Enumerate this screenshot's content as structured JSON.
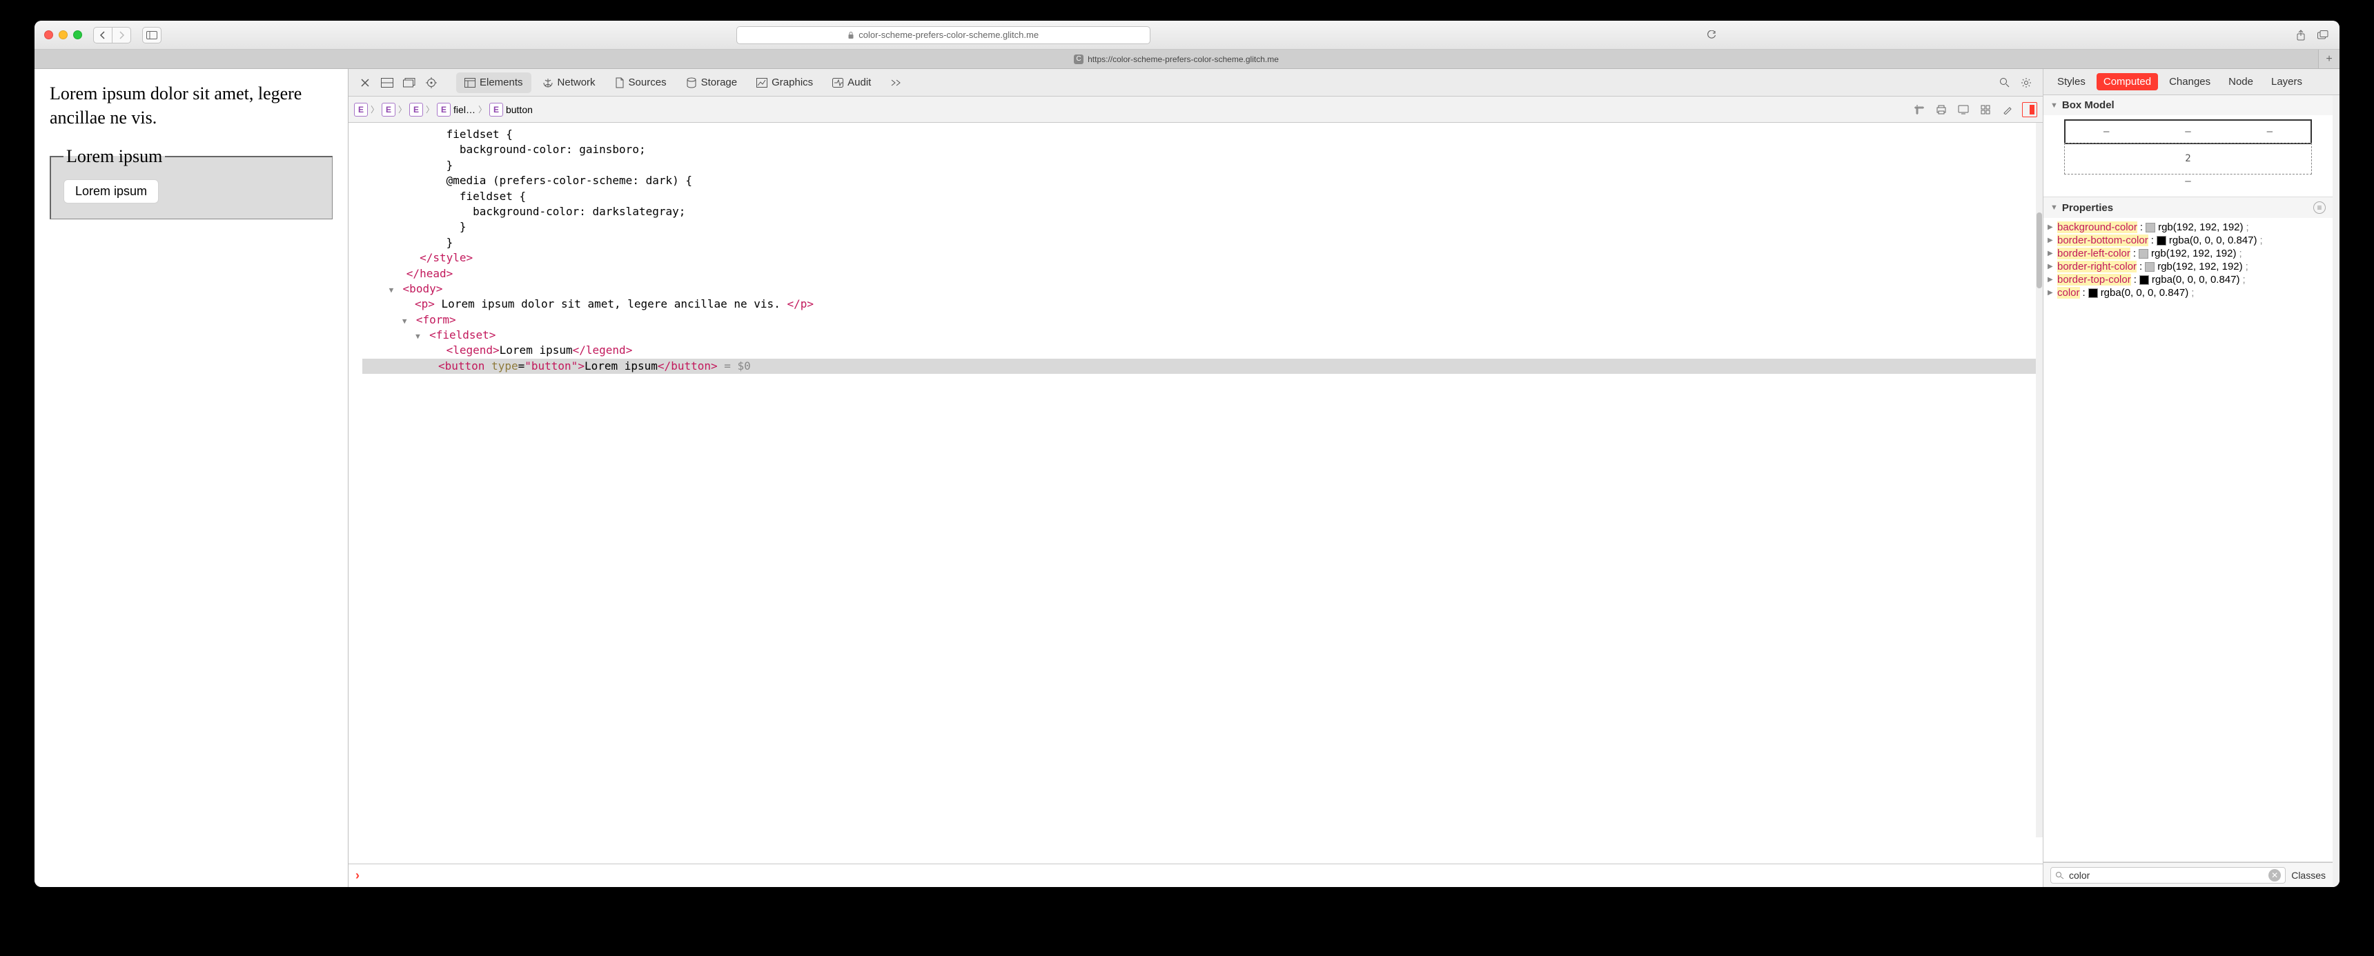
{
  "browser": {
    "url": "color-scheme-prefers-color-scheme.glitch.me",
    "tab_url": "https://color-scheme-prefers-color-scheme.glitch.me"
  },
  "page": {
    "paragraph": "Lorem ipsum dolor sit amet, legere ancillae ne vis.",
    "legend": "Lorem ipsum",
    "button": "Lorem ipsum"
  },
  "devtools": {
    "tabs": {
      "elements": "Elements",
      "network": "Network",
      "sources": "Sources",
      "storage": "Storage",
      "graphics": "Graphics",
      "audit": "Audit"
    },
    "breadcrumb": [
      "",
      "",
      "",
      "fiel…",
      "button"
    ],
    "source_lines": [
      "            fieldset {",
      "              background-color: gainsboro;",
      "            }",
      "            @media (prefers-color-scheme: dark) {",
      "              fieldset {",
      "                background-color: darkslategray;",
      "              }",
      "            }"
    ],
    "paragraph_text": "Lorem ipsum dolor sit amet, legere ancillae ne vis.",
    "button_text": "Lorem ipsum",
    "console_ref": "= $0"
  },
  "rightpanel": {
    "tabs": [
      "Styles",
      "Computed",
      "Changes",
      "Node",
      "Layers"
    ],
    "active_tab": "Computed",
    "boxmodel_title": "Box Model",
    "boxmodel_margin_bottom": "2",
    "boxmodel_margin_center": "–",
    "properties_title": "Properties",
    "properties": [
      {
        "name": "background-color",
        "swatch": "#c0c0c0",
        "value": "rgb(192, 192, 192)"
      },
      {
        "name": "border-bottom-color",
        "swatch": "#000000",
        "value": "rgba(0, 0, 0, 0.847)"
      },
      {
        "name": "border-left-color",
        "swatch": "#c0c0c0",
        "value": "rgb(192, 192, 192)"
      },
      {
        "name": "border-right-color",
        "swatch": "#c0c0c0",
        "value": "rgb(192, 192, 192)"
      },
      {
        "name": "border-top-color",
        "swatch": "#000000",
        "value": "rgba(0, 0, 0, 0.847)"
      },
      {
        "name": "color",
        "swatch": "#000000",
        "value": "rgba(0, 0, 0, 0.847)"
      }
    ],
    "filter_value": "color",
    "classes_label": "Classes"
  }
}
